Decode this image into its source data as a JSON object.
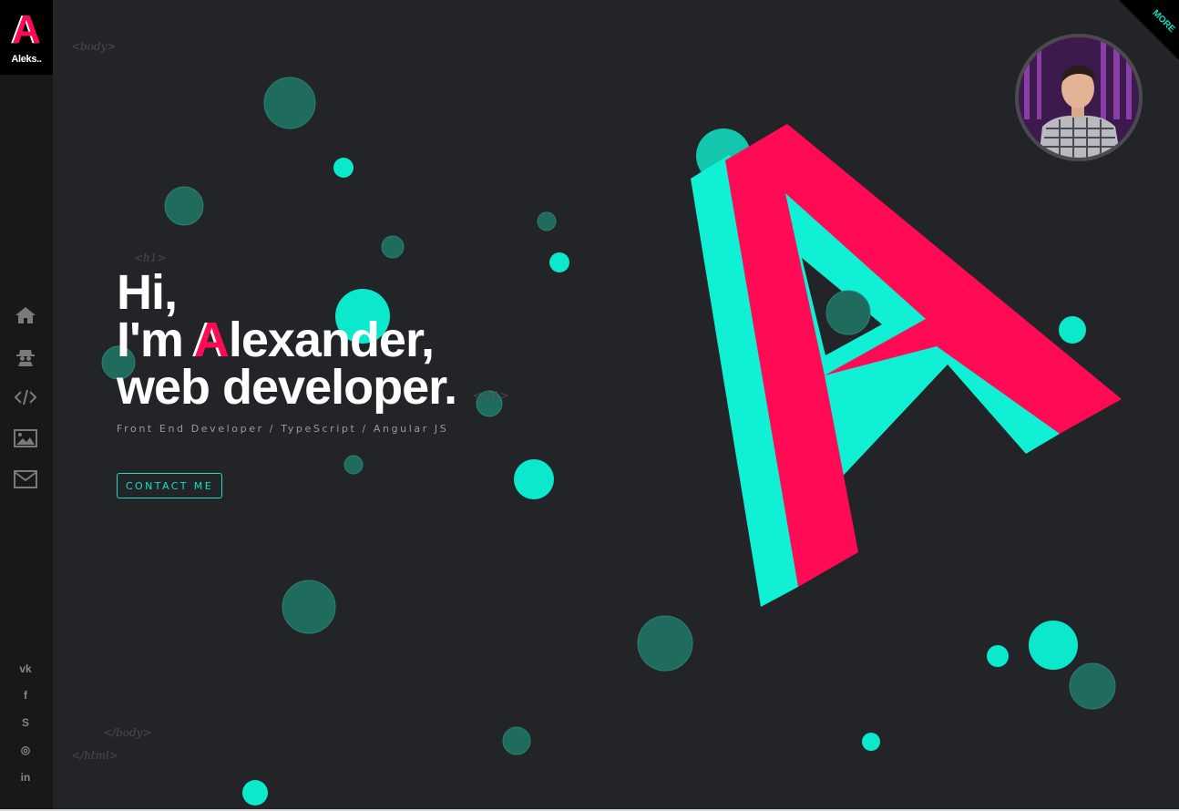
{
  "brand": {
    "logo_letter": "A",
    "short_name": "Aleks.."
  },
  "corner": {
    "more_label": "MORE"
  },
  "code_tags": {
    "body_open": "<body>",
    "h1_open": "<h1>",
    "h1_close": "</h1>",
    "body_close": "</body>",
    "html_close": "</html>"
  },
  "hero": {
    "line1": "Hi,",
    "line2_prefix": "I'm ",
    "line2_accent": "A",
    "line2_rest": "lexander,",
    "line3": "web developer.",
    "subtitle": "Front End Developer / TypeScript / Angular JS",
    "contact_label": "CONTACT ME"
  },
  "nav": {
    "items": [
      {
        "icon": "home-icon"
      },
      {
        "icon": "spy-icon"
      },
      {
        "icon": "code-icon"
      },
      {
        "icon": "image-icon"
      },
      {
        "icon": "mail-icon"
      }
    ]
  },
  "social": {
    "items": [
      {
        "icon": "vk-icon",
        "glyph": "vk"
      },
      {
        "icon": "facebook-icon",
        "glyph": "f"
      },
      {
        "icon": "skype-icon",
        "glyph": "S"
      },
      {
        "icon": "instagram-icon",
        "glyph": "◎"
      },
      {
        "icon": "linkedin-icon",
        "glyph": "in"
      }
    ]
  },
  "colors": {
    "background": "#232427",
    "sidebar": "#181818",
    "accent_teal": "#10e0c4",
    "accent_pink": "#ff0a54",
    "dark_teal": "#1e6b5e"
  }
}
